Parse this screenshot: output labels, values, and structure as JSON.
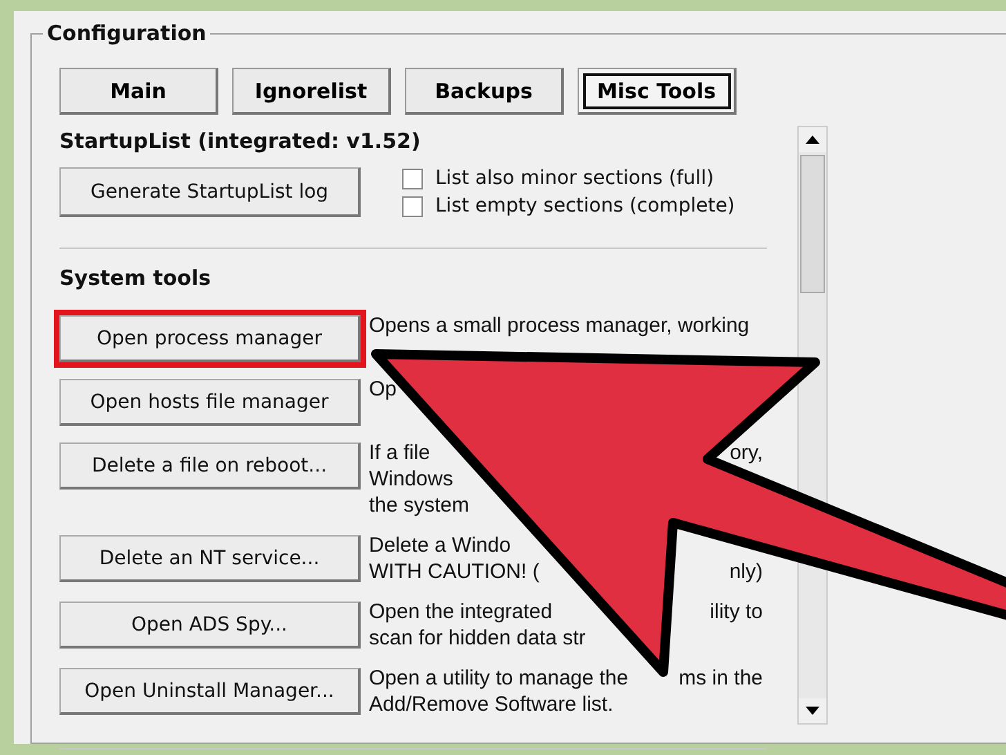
{
  "group_title": "Configuration",
  "tabs": [
    {
      "label": "Main",
      "selected": false
    },
    {
      "label": "Ignorelist",
      "selected": false
    },
    {
      "label": "Backups",
      "selected": false
    },
    {
      "label": "Misc Tools",
      "selected": true
    }
  ],
  "startuplist": {
    "heading": "StartupList (integrated: v1.52)",
    "button": "Generate StartupList log",
    "options": [
      {
        "label": "List also minor sections (full)",
        "checked": false
      },
      {
        "label": "List empty sections (complete)",
        "checked": false
      }
    ]
  },
  "system_tools": {
    "heading": "System tools",
    "tools": [
      {
        "button": "Open process manager",
        "highlighted": true,
        "description": [
          {
            "text": "Opens a small process manager, working"
          }
        ]
      },
      {
        "button": "Open hosts file manager",
        "highlighted": false,
        "description": [
          {
            "text": "Op"
          }
        ]
      },
      {
        "button": "Delete a file on reboot...",
        "highlighted": false,
        "description": [
          {
            "text": "If a file",
            "end": "ory,"
          },
          {
            "text": "Windows"
          },
          {
            "text": "the system"
          }
        ]
      },
      {
        "button": "Delete an NT service...",
        "highlighted": false,
        "description": [
          {
            "text": "Delete a Windo"
          },
          {
            "text": "WITH CAUTION! (",
            "end": "nly)"
          }
        ]
      },
      {
        "button": "Open ADS Spy...",
        "highlighted": false,
        "description": [
          {
            "text": "Open the integrated",
            "end": "ility to"
          },
          {
            "text": "scan for hidden data str"
          }
        ]
      },
      {
        "button": "Open Uninstall Manager...",
        "highlighted": false,
        "description": [
          {
            "text": "Open a utility to manage the",
            "end": "ms in the"
          },
          {
            "text": "Add/Remove Software list."
          }
        ]
      }
    ]
  }
}
